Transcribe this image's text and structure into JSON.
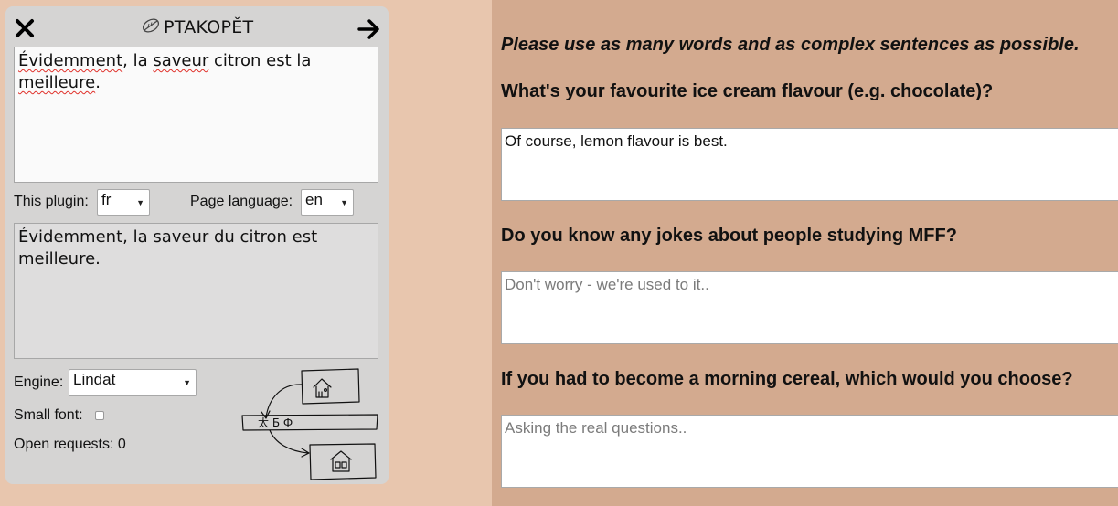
{
  "plugin": {
    "title": "PTAKOPĚT",
    "icons": {
      "close": "close-x-icon",
      "logo": "leaf-icon",
      "next": "arrow-right-icon"
    },
    "source_text": {
      "w1": "Évidemment",
      "w2": ", la ",
      "w3": "saveur",
      "w4": " citron est la ",
      "w5": "meilleure",
      "w6": "."
    },
    "this_plugin_label": "This plugin:",
    "this_plugin_value": "fr",
    "page_language_label": "Page language:",
    "page_language_value": "en",
    "backtranslation": "Évidemment, la saveur du citron est meilleure.",
    "engine_label": "Engine:",
    "engine_value": "Lindat",
    "small_font_label": "Small font:",
    "small_font_checked": false,
    "open_requests": "Open requests: 0",
    "illustration_glyphs": "太 Б Ф"
  },
  "form": {
    "instructions": "Please use as many words and as complex sentences as possible.",
    "questions": [
      {
        "label": "What's your favourite ice cream flavour (e.g. chocolate)?",
        "value": "Of course, lemon flavour is best.",
        "placeholder": ""
      },
      {
        "label": "Do you know any jokes about people studying MFF?",
        "value": "",
        "placeholder": "Don't worry - we're used to it.."
      },
      {
        "label": "If you had to become a morning cereal, which would you choose?",
        "value": "",
        "placeholder": "Asking the real questions.."
      }
    ]
  },
  "colors": {
    "page_left_background": "#e8c6ae",
    "page_right_background": "#d3aa8f",
    "panel_background": "#d5d4d3",
    "backtranslation_background": "#dedddd",
    "spellcheck_underline": "#e0302a",
    "placeholder_text": "#7b7b7b"
  }
}
